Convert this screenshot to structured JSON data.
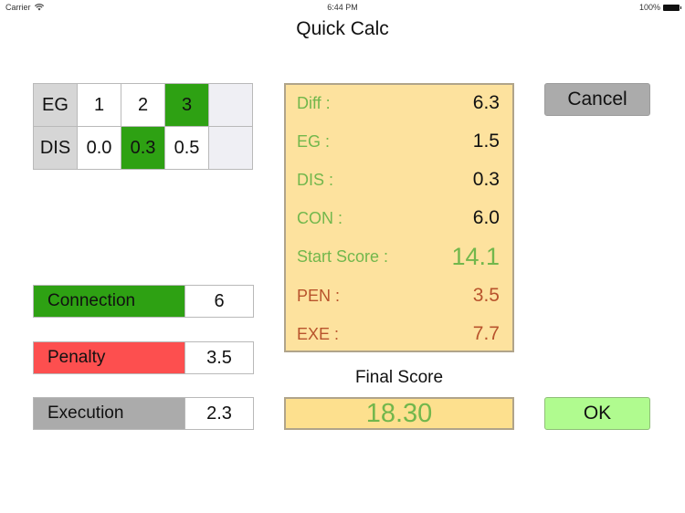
{
  "status_bar": {
    "carrier": "Carrier",
    "time": "6:44 PM",
    "battery": "100%"
  },
  "title": "Quick Calc",
  "grid": {
    "rows": [
      {
        "label": "EG",
        "cells": [
          {
            "text": "1",
            "selected": false
          },
          {
            "text": "2",
            "selected": false
          },
          {
            "text": "3",
            "selected": true
          },
          {
            "text": "",
            "selected": false
          }
        ]
      },
      {
        "label": "DIS",
        "cells": [
          {
            "text": "0.0",
            "selected": false
          },
          {
            "text": "0.3",
            "selected": true
          },
          {
            "text": "0.5",
            "selected": false
          },
          {
            "text": "",
            "selected": false
          }
        ]
      }
    ]
  },
  "inputs": {
    "connection": {
      "label": "Connection",
      "value": "6"
    },
    "penalty": {
      "label": "Penalty",
      "value": "3.5"
    },
    "execution": {
      "label": "Execution",
      "value": "2.3"
    }
  },
  "summary": {
    "diff": {
      "label": "Diff :",
      "value": "6.3"
    },
    "eg": {
      "label": "EG :",
      "value": "1.5"
    },
    "dis": {
      "label": "DIS :",
      "value": "0.3"
    },
    "con": {
      "label": "CON :",
      "value": "6.0"
    },
    "start": {
      "label": "Start Score :",
      "value": "14.1"
    },
    "pen": {
      "label": "PEN :",
      "value": "3.5"
    },
    "exe": {
      "label": "EXE :",
      "value": "7.7"
    }
  },
  "final": {
    "label": "Final Score",
    "value": "18.30"
  },
  "buttons": {
    "cancel": "Cancel",
    "ok": "OK"
  },
  "colors": {
    "selected_green": "#2ea113",
    "penalty_red": "#fd4f4f",
    "panel_yellow": "#fde29e",
    "ok_green": "#b0fb8f"
  }
}
